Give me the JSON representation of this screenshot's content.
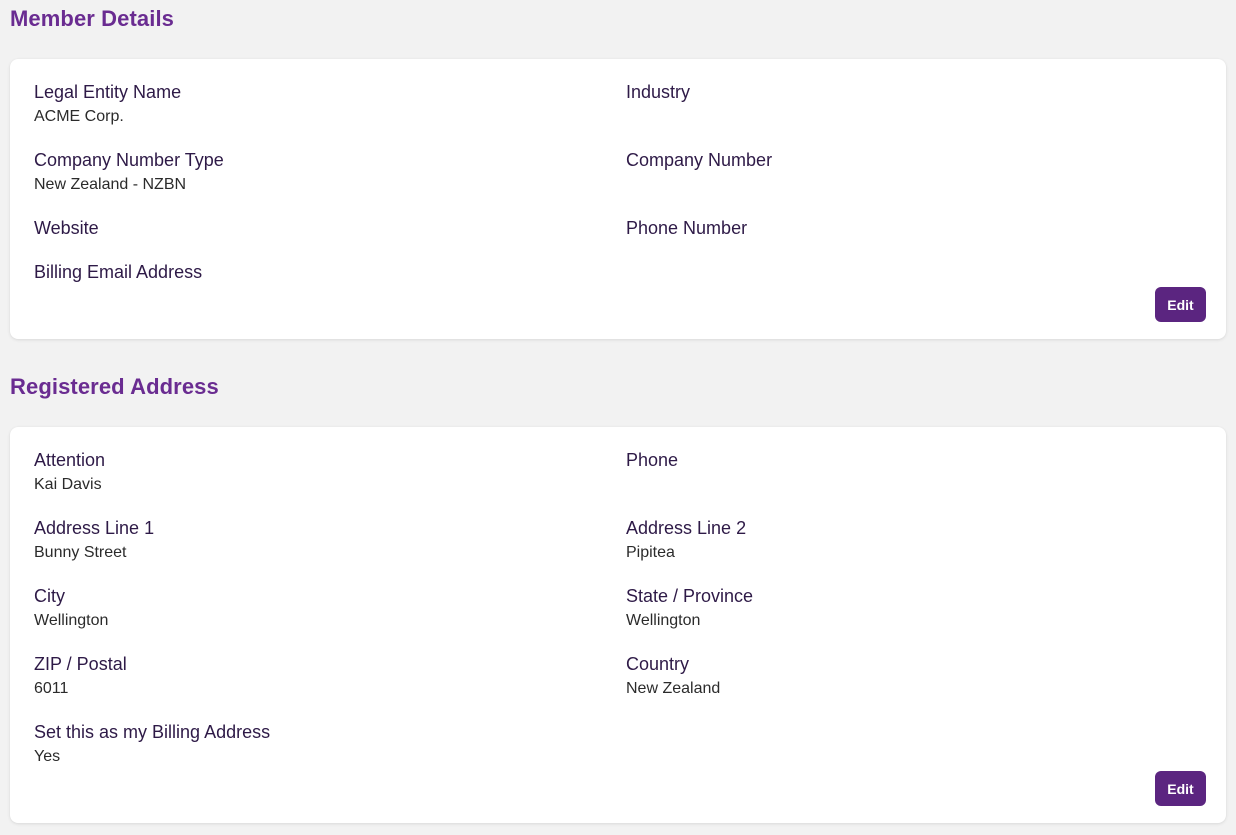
{
  "member": {
    "title": "Member Details",
    "fields": {
      "legal_entity_name": {
        "label": "Legal Entity Name",
        "value": "ACME Corp."
      },
      "industry": {
        "label": "Industry",
        "value": ""
      },
      "company_number_type": {
        "label": "Company Number Type",
        "value": "New Zealand - NZBN"
      },
      "company_number": {
        "label": "Company Number",
        "value": ""
      },
      "website": {
        "label": "Website",
        "value": ""
      },
      "phone_number": {
        "label": "Phone Number",
        "value": ""
      },
      "billing_email": {
        "label": "Billing Email Address",
        "value": ""
      }
    },
    "edit_label": "Edit"
  },
  "address": {
    "title": "Registered Address",
    "fields": {
      "attention": {
        "label": "Attention",
        "value": "Kai Davis"
      },
      "phone": {
        "label": "Phone",
        "value": ""
      },
      "address_line_1": {
        "label": "Address Line 1",
        "value": "Bunny Street"
      },
      "address_line_2": {
        "label": "Address Line 2",
        "value": "Pipitea"
      },
      "city": {
        "label": "City",
        "value": "Wellington"
      },
      "state_province": {
        "label": "State / Province",
        "value": "Wellington"
      },
      "zip_postal": {
        "label": "ZIP / Postal",
        "value": "6011"
      },
      "country": {
        "label": "Country",
        "value": "New Zealand"
      },
      "billing_address": {
        "label": "Set this as my Billing Address",
        "value": "Yes"
      }
    },
    "edit_label": "Edit"
  },
  "colors": {
    "heading": "#6a2c91",
    "button": "#5b2580",
    "background": "#f2f2f2",
    "card": "#ffffff"
  }
}
